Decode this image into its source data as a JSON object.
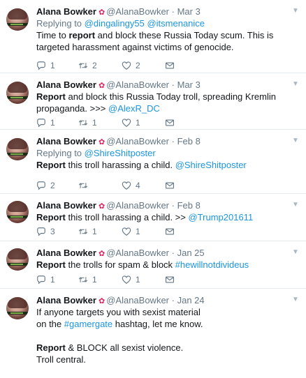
{
  "tweets": [
    {
      "name": "Alana Bowker",
      "handle": "@AlanaBowker",
      "dot": "·",
      "date": "Mar 3",
      "reply_prefix": "Replying to ",
      "reply_to": "@dingalingy55 @itsmenanice",
      "t1": "Time to ",
      "t2": "report",
      "t3": " and block these Russia Today scum. This is targeted harassment against victims of genocide.",
      "replies": "1",
      "retweets": "2",
      "likes": "2"
    },
    {
      "name": "Alana Bowker",
      "handle": "@AlanaBowker",
      "dot": "·",
      "date": "Mar 3",
      "t1": "Report",
      "t2": " and block this Russia Today troll, spreading Kremlin propaganda. >>> ",
      "t3": "@AlexR_DC",
      "replies": "1",
      "retweets": "1",
      "likes": "1"
    },
    {
      "name": "Alana Bowker",
      "handle": "@AlanaBowker",
      "dot": "·",
      "date": "Feb 8",
      "reply_prefix": "Replying to ",
      "reply_to": "@ShireShitposter",
      "t1": "Report",
      "t2": " this troll harassing a child. ",
      "t3": "@ShireShitposter",
      "replies": "2",
      "retweets": "",
      "likes": "4"
    },
    {
      "name": "Alana Bowker",
      "handle": "@AlanaBowker",
      "dot": "·",
      "date": "Feb 8",
      "t1": "Report",
      "t2": " this troll harassing a child. >> ",
      "t3": "@Trump201611",
      "replies": "3",
      "retweets": "1",
      "likes": "1"
    },
    {
      "name": "Alana Bowker",
      "handle": "@AlanaBowker",
      "dot": "·",
      "date": "Jan 25",
      "t1": "Report",
      "t2": " the trolls for spam & block ",
      "t3": "#hewillnotdivideus",
      "replies": "1",
      "retweets": "1",
      "likes": "1"
    },
    {
      "name": "Alana Bowker",
      "handle": "@AlanaBowker",
      "dot": "·",
      "date": "Jan 24",
      "p1": "If anyone targets you with sexist material",
      "p2a": "on the ",
      "p2b": "#gamergate",
      "p2c": " hashtag, let me know.",
      "p3a": "Report",
      "p3b": " & BLOCK all sexist violence.",
      "p4": "Troll central."
    }
  ],
  "icons": {
    "verified_leaf": "maple-leaf-icon",
    "caret": "chevron-down-icon",
    "reply": "reply-icon",
    "retweet": "retweet-icon",
    "like": "heart-icon",
    "dm": "envelope-icon"
  },
  "colors": {
    "link": "#1b95e0",
    "muted": "#657786",
    "leaf": "#e0245e"
  }
}
